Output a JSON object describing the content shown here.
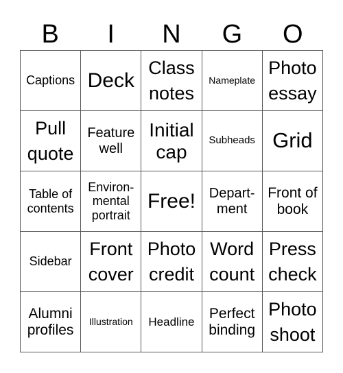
{
  "header": {
    "letters": [
      "B",
      "I",
      "N",
      "G",
      "O"
    ]
  },
  "grid": {
    "rows": [
      [
        "Captions",
        "Deck",
        "Class notes",
        "Nameplate",
        "Photo essay"
      ],
      [
        "Pull quote",
        "Feature well",
        "Initial cap",
        "Subheads",
        "Grid"
      ],
      [
        "Table of contents",
        "Environ- mental portrait",
        "Free!",
        "Depart- ment",
        "Front of book"
      ],
      [
        "Sidebar",
        "Front cover",
        "Photo credit",
        "Word count",
        "Press check"
      ],
      [
        "Alumni profiles",
        "Illustration",
        "Headline",
        "Perfect binding",
        "Photo shoot"
      ]
    ]
  }
}
